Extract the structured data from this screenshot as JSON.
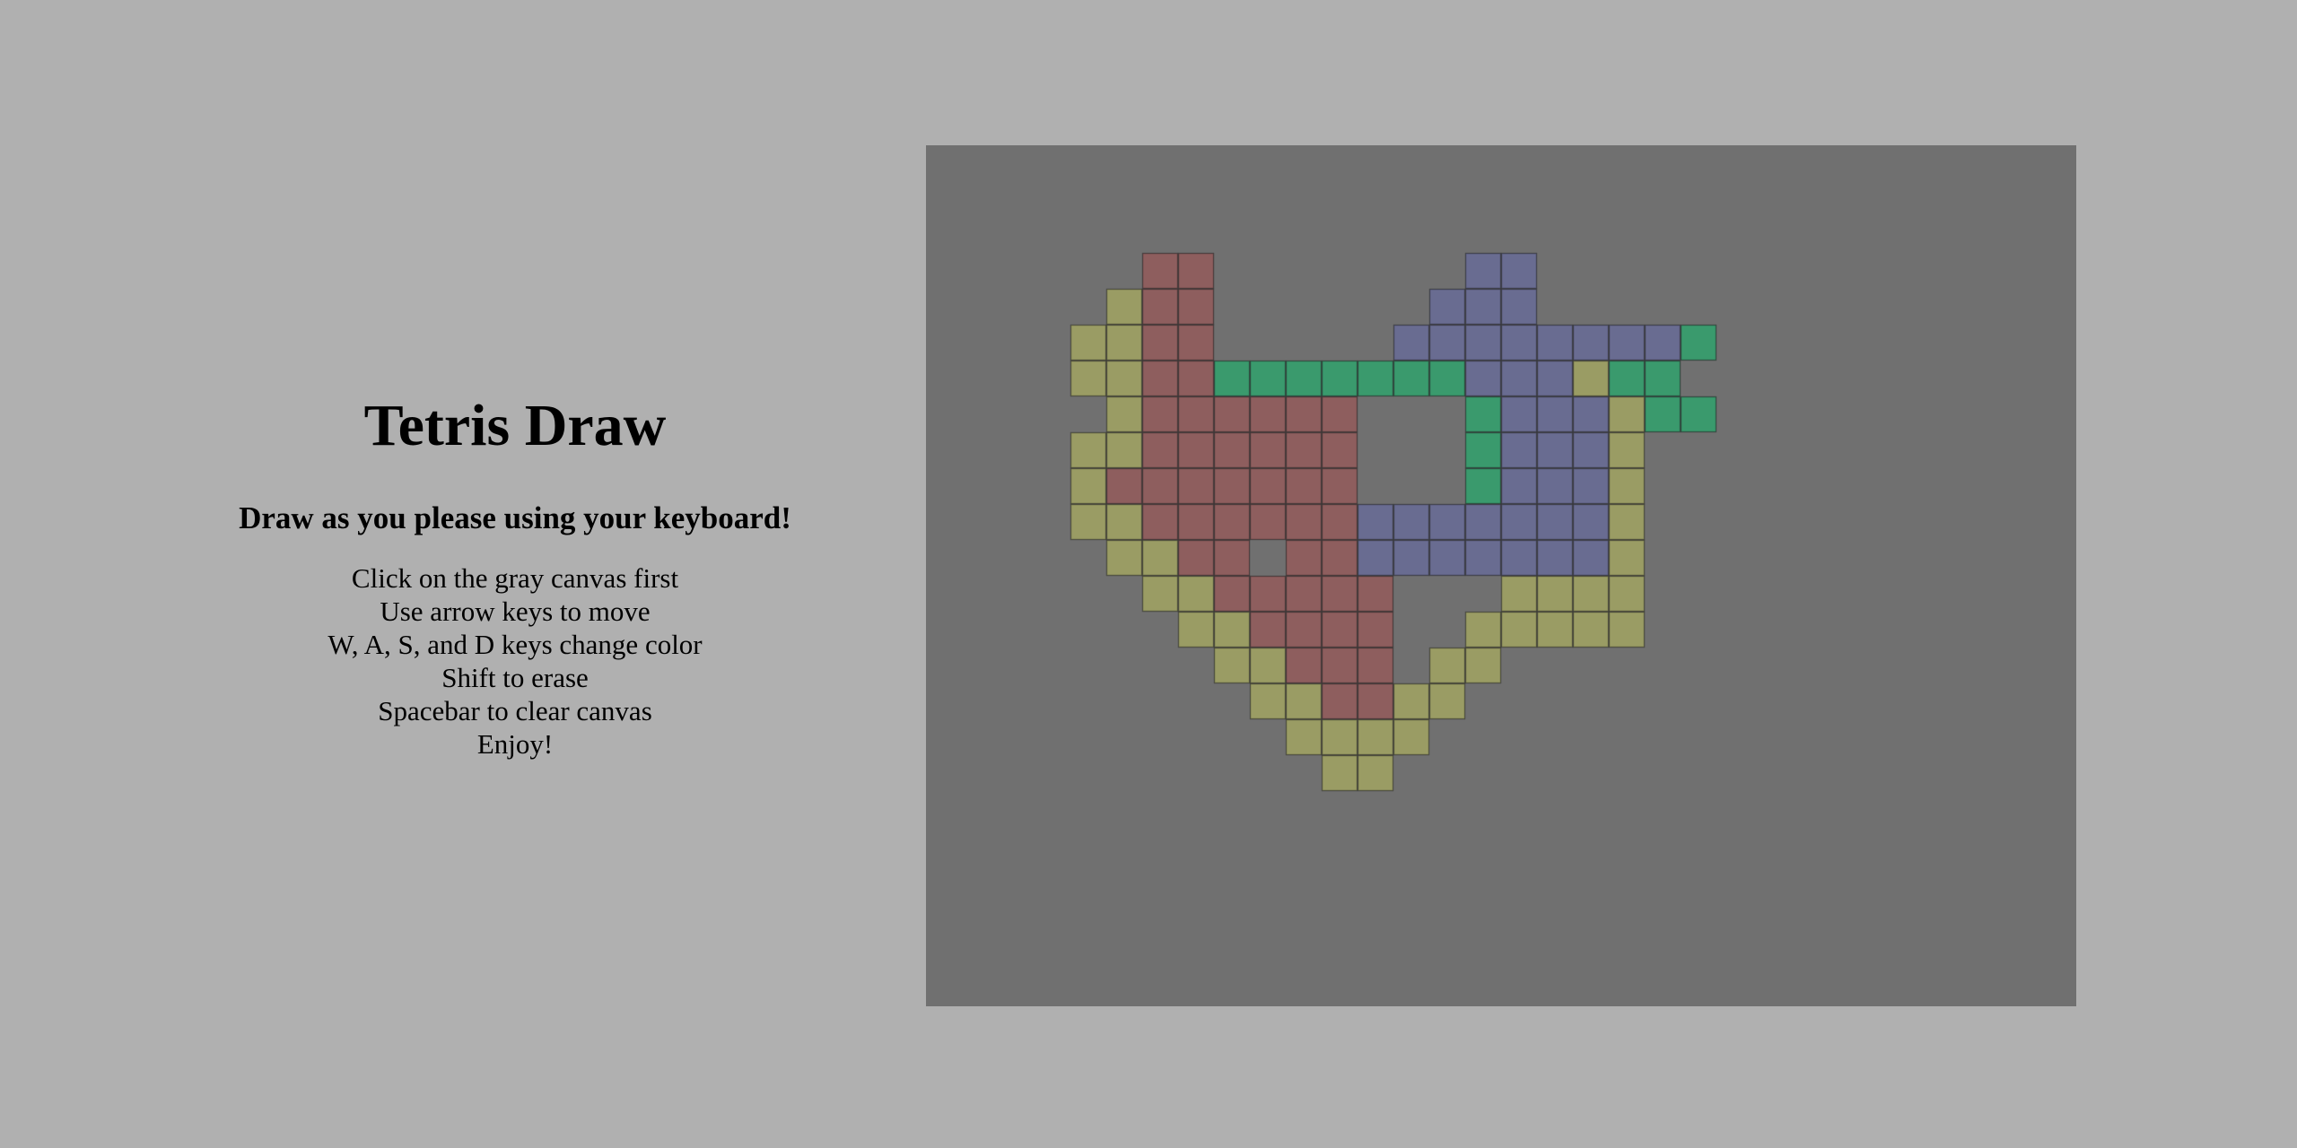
{
  "title": "Tetris Draw",
  "subtitle": "Draw as you please using your keyboard!",
  "instructions": [
    "Click on the gray canvas first",
    "Use arrow keys to move",
    "W, A, S, and D keys change color",
    "Shift to erase",
    "Spacebar to clear canvas",
    "Enjoy!"
  ],
  "colors": {
    "page_background": "#b0b0b0",
    "canvas_background": "#707070",
    "red": "#8e5e5e",
    "blue": "#696c91",
    "green": "#3a9a6d",
    "olive": "#9a9c64"
  },
  "drawing": [
    ".....RR.......BB.........",
    "....YRR......BBB.........",
    "...YYRR.....BBBBBBBBG....",
    "...YYRRGGGGGGGBBBYGG.....",
    "....YRRRRRR...GBBBYGG....",
    "...YYRRRRRR...GBBBY......",
    "...YRRRRRRR...GBBBY......",
    "...YYRRRRRRBBBBBBBY......",
    "....YYRR.RRBBBBBBBY......",
    ".....YYRRRRR...YYYY......",
    "......YYRRRR..YYYYY......",
    ".......YYRRR.YY..........",
    "........YYRRYY...........",
    ".........YYYY............",
    "..........YY............."
  ]
}
